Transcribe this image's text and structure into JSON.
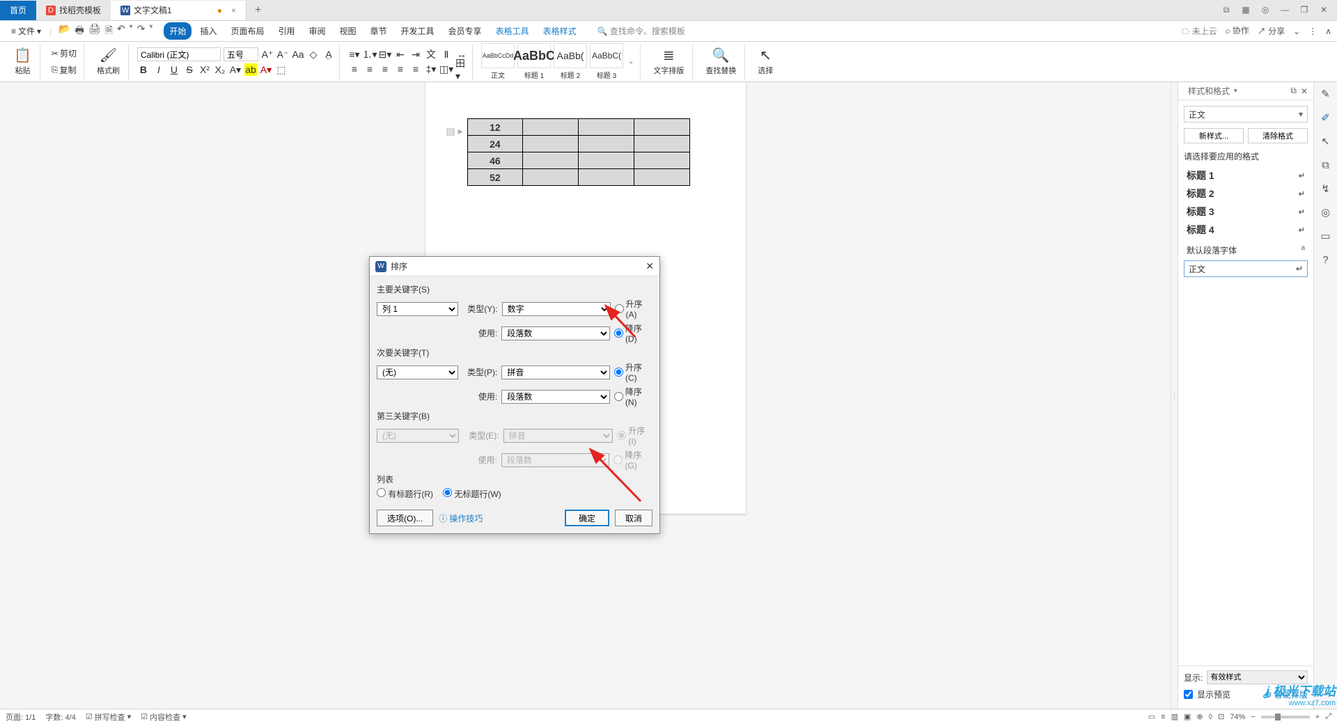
{
  "tabs": {
    "home": "首页",
    "template": "找稻壳模板",
    "doc": "文字文稿1",
    "plus": "+"
  },
  "win": {
    "layout_icon": "⧉",
    "grid_icon": "▦",
    "avatar": "◎",
    "min": "—",
    "restore": "❐",
    "close": "✕"
  },
  "file_menu": {
    "hamburger": "≡",
    "label": "文件",
    "caret": "▾"
  },
  "qat": {
    "open": "📂",
    "print": "🖶",
    "preview": "🖨",
    "save": "🗎",
    "undo": "↶",
    "redo": "↷"
  },
  "menus": [
    "开始",
    "插入",
    "页面布局",
    "引用",
    "审阅",
    "视图",
    "章节",
    "开发工具",
    "会员专享",
    "表格工具",
    "表格样式"
  ],
  "menu_extra": {
    "search_placeholder": "查找命令、搜索模板"
  },
  "menu_right": {
    "cloud": "☁ 未上云",
    "coop": "ဝ 协作",
    "share": "↗ 分享",
    "caret": "⌄",
    "more": "⋮"
  },
  "ribbon": {
    "paste": "粘贴",
    "cut": "剪切",
    "copy": "复制",
    "format_painter": "格式刷",
    "font_name": "Calibri (正文)",
    "font_size": "五号",
    "bold": "B",
    "italic": "I",
    "underline": "U",
    "strike": "S",
    "styles_preview": [
      {
        "preview": "AaBbCcDd",
        "name": "正文"
      },
      {
        "preview": "AaBbC",
        "name": "标题 1"
      },
      {
        "preview": "AaBb(",
        "name": "标题 2"
      },
      {
        "preview": "AaBbC(",
        "name": "标题 3"
      }
    ],
    "text_layout": "文字排版",
    "find_replace": "查找替换",
    "select": "选择"
  },
  "table_data": [
    "12",
    "24",
    "46",
    "52"
  ],
  "styles_panel": {
    "title": "样式和格式",
    "current": "正文",
    "new_style": "新样式...",
    "clear": "清除格式",
    "hint": "请选择要应用的格式",
    "items": [
      "标题 1",
      "标题 2",
      "标题 3",
      "标题 4"
    ],
    "para_font": "默认段落字体",
    "body": "正文",
    "show_label": "显示:",
    "show_value": "有效样式",
    "preview_label": "显示预览",
    "smart_layout": "智能排版"
  },
  "dialog": {
    "title": "排序",
    "section1": "主要关键字(S)",
    "section2": "次要关键字(T)",
    "section3": "第三关键字(B)",
    "col1": "列 1",
    "none": "(无)",
    "type_label_y": "类型(Y):",
    "type_label_p": "类型(P):",
    "type_label_e": "类型(E):",
    "use_label": "使用:",
    "type_number": "数字",
    "type_pinyin": "拼音",
    "use_para": "段落数",
    "asc_a": "升序(A)",
    "desc_d": "降序(D)",
    "asc_c": "升序(C)",
    "desc_n": "降序(N)",
    "asc_i": "升序(I)",
    "desc_g": "降序(G)",
    "list_label": "列表",
    "header_yes": "有标题行(R)",
    "header_no": "无标题行(W)",
    "options": "选项(O)...",
    "tips": "操作技巧",
    "ok": "确定",
    "cancel": "取消"
  },
  "status": {
    "page": "页面: 1/1",
    "words": "字数: 4/4",
    "spell": "拼写检查",
    "content": "内容检查",
    "zoom": "74%"
  },
  "watermark": {
    "line1": "极光下载站",
    "line2": "www.xz7.com"
  }
}
